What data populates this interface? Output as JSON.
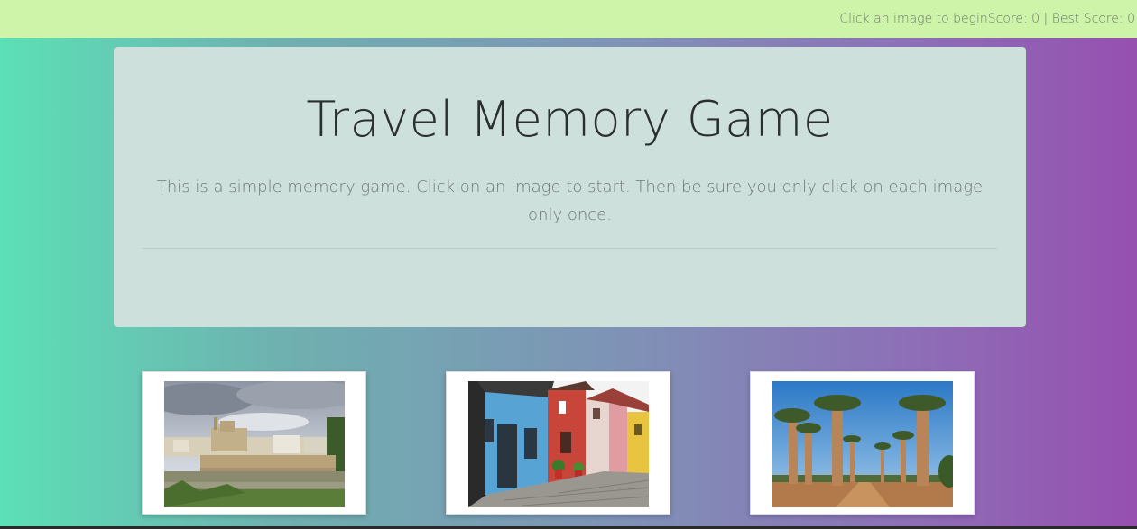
{
  "navbar": {
    "status_text": "Click an image to begin",
    "score_text": "Score: 0 | Best Score: 0"
  },
  "header": {
    "title": "Travel Memory Game",
    "description": "This is a simple memory game. Click on an image to start. Then be sure you only click on each image only once."
  },
  "cards": [
    {
      "scene": "river-bridge-city"
    },
    {
      "scene": "colorful-houses-street"
    },
    {
      "scene": "baobab-avenue"
    }
  ],
  "colors": {
    "navbar_bg": "#cdf4a9",
    "jumbotron_bg": "#cde0dc",
    "gradient_left": "#5ce0b6",
    "gradient_right": "#9650b0"
  }
}
